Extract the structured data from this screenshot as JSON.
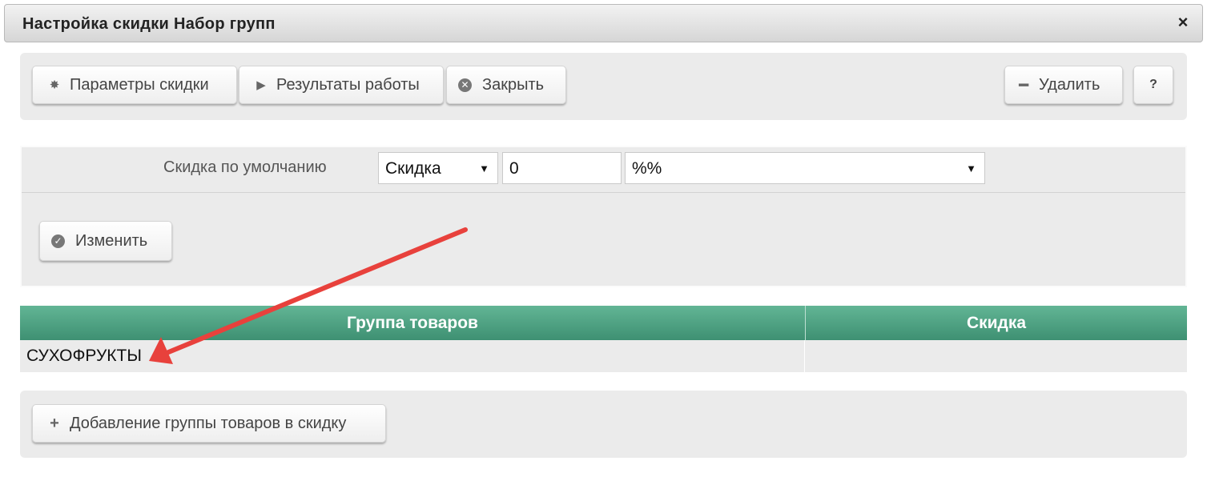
{
  "window": {
    "title": "Настройка скидки Набор групп",
    "close_label": "×"
  },
  "toolbar": {
    "params_label": "Параметры скидки",
    "results_label": "Результаты работы",
    "close_label": "Закрыть",
    "delete_label": "Удалить",
    "help_label": "?"
  },
  "form": {
    "default_discount_label": "Скидка по умолчанию",
    "type_select_value": "Скидка",
    "amount_value": "0",
    "unit_select_value": "%%",
    "apply_label": "Изменить"
  },
  "grid": {
    "columns": [
      "Группа товаров",
      "Скидка"
    ],
    "rows": [
      {
        "group": "СУХОФРУКТЫ",
        "discount": ""
      }
    ]
  },
  "footer": {
    "add_group_label": "Добавление группы товаров в скидку"
  },
  "colors": {
    "grid_header": "#4fa384",
    "annotation_arrow": "#e8413c",
    "panel_bg": "#ebebeb"
  },
  "icons": {
    "params": "gear-icon",
    "results": "play-icon",
    "close": "close-circle-icon",
    "delete": "minus-icon",
    "apply": "check-circle-icon",
    "add": "plus-icon"
  }
}
